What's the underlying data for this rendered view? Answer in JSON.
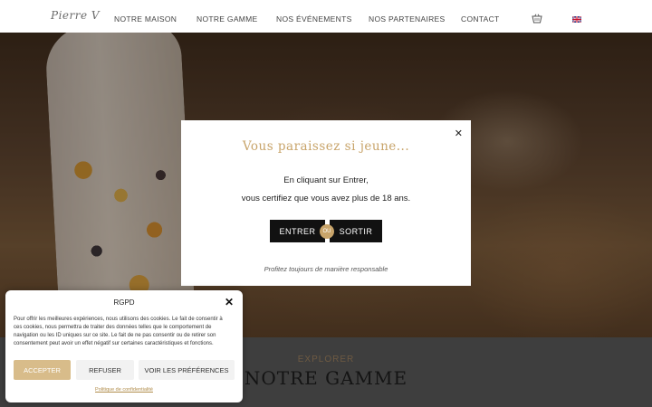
{
  "header": {
    "logo": "Pierre V",
    "nav": [
      {
        "label": "NOTRE MAISON"
      },
      {
        "label": "NOTRE GAMME"
      },
      {
        "label": "NOS ÉVÉNEMENTS"
      },
      {
        "label": "NOS PARTENAIRES"
      },
      {
        "label": "CONTACT"
      }
    ],
    "cart_icon": "basket-icon",
    "language_icon": "uk-flag-icon"
  },
  "section": {
    "kicker": "EXPLORER",
    "title": "NOTRE GAMME"
  },
  "age_gate": {
    "title": "Vous paraissez si jeune...",
    "line1": "En cliquant sur Entrer,",
    "line2": "vous certifiez que vous avez plus de 18 ans.",
    "enter_label": "ENTRER",
    "or_label": "OU",
    "exit_label": "SORTIR",
    "footer": "Profitez toujours de manière responsable",
    "close_label": "✕"
  },
  "cookie": {
    "title": "RGPD",
    "close_label": "✕",
    "text": "Pour offrir les meilleures expériences, nous utilisons des cookies. Le fait de consentir à ces cookies, nous permettra de traiter des données telles que le comportement de navigation ou les ID uniques sur ce site. Le fait de ne pas consentir ou de retirer son consentement peut avoir un effet négatif sur certaines caractéristiques et fonctions.",
    "accept_label": "ACCEPTER",
    "refuse_label": "REFUSER",
    "prefs_label": "VOIR LES PRÉFÉRENCES",
    "policy_link": "Politique de confidentialité"
  },
  "colors": {
    "gold": "#c8a46a",
    "accept_bg": "#d8bc8a",
    "button_dark": "#111111"
  }
}
